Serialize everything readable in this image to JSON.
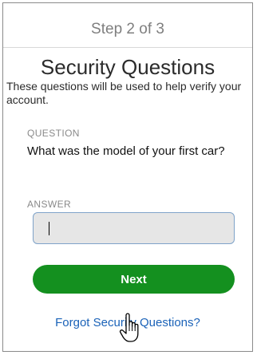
{
  "step_indicator": "Step 2 of 3",
  "title": "Security Questions",
  "subtitle": "These questions will be used to help verify your account.",
  "question": {
    "label": "QUESTION",
    "text": "What was the model of your first car?"
  },
  "answer": {
    "label": "ANSWER",
    "value": ""
  },
  "next_button_label": "Next",
  "forgot_link_label": "Forgot Security Questions?",
  "colors": {
    "primary_button": "#14901f",
    "link": "#1a62b8",
    "input_background": "#e6e6e6",
    "input_border": "#7fa3c9"
  },
  "icons": {
    "pointer": "hand-pointer-icon"
  }
}
